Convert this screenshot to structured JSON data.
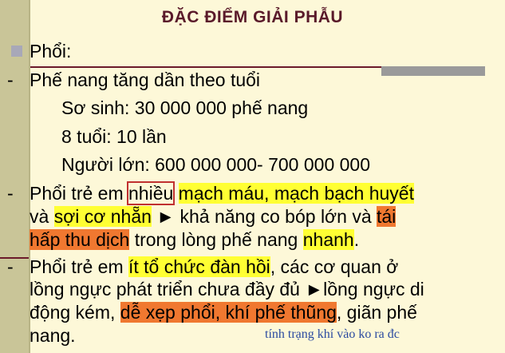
{
  "title": "ĐẶC ĐIỂM GIẢI PHẪU",
  "heading": "Phổi:",
  "bullet1": {
    "text": "Phế nang tăng dần theo tuổi",
    "sub": [
      "Sơ sinh: 30 000 000 phế nang",
      "8 tuổi: 10 lần",
      "Người lớn: 600 000 000- 700 000 000"
    ]
  },
  "bullet2": {
    "l1_a": "Phổi trẻ em ",
    "l1_box": "nhiều",
    "l1_b": " ",
    "l1_hl": "mạch máu, mạch bạch huyết",
    "l2_a": "và ",
    "l2_hl": "sợi cơ nhẵn",
    "l2_b": " ► khả năng co bóp lớn và ",
    "l2_hl2": "tái",
    "l3_hl": "hấp thu dịch",
    "l3_b": " trong lòng phế nang ",
    "l3_hl2": "nhanh",
    "l3_c": "."
  },
  "bullet3": {
    "l1_a": "Phổi trẻ em ",
    "l1_hl": "ít tổ chức đàn hồi",
    "l1_b": ", các cơ quan ở",
    "l2": "lồng ngực phát triển chưa đầy đủ  ►lồng ngực di",
    "l3_a": "động kém, ",
    "l3_hl": "dễ xẹp phổi, khí phế thũng",
    "l3_b": ", giãn phế",
    "l4": "nang."
  },
  "note": "tính trạng khí vào ko ra đc",
  "colors": {
    "highlight_yellow": "#ffff33",
    "highlight_orange": "#f07830",
    "title": "#5a1a2a",
    "note": "#2a4aa0"
  }
}
